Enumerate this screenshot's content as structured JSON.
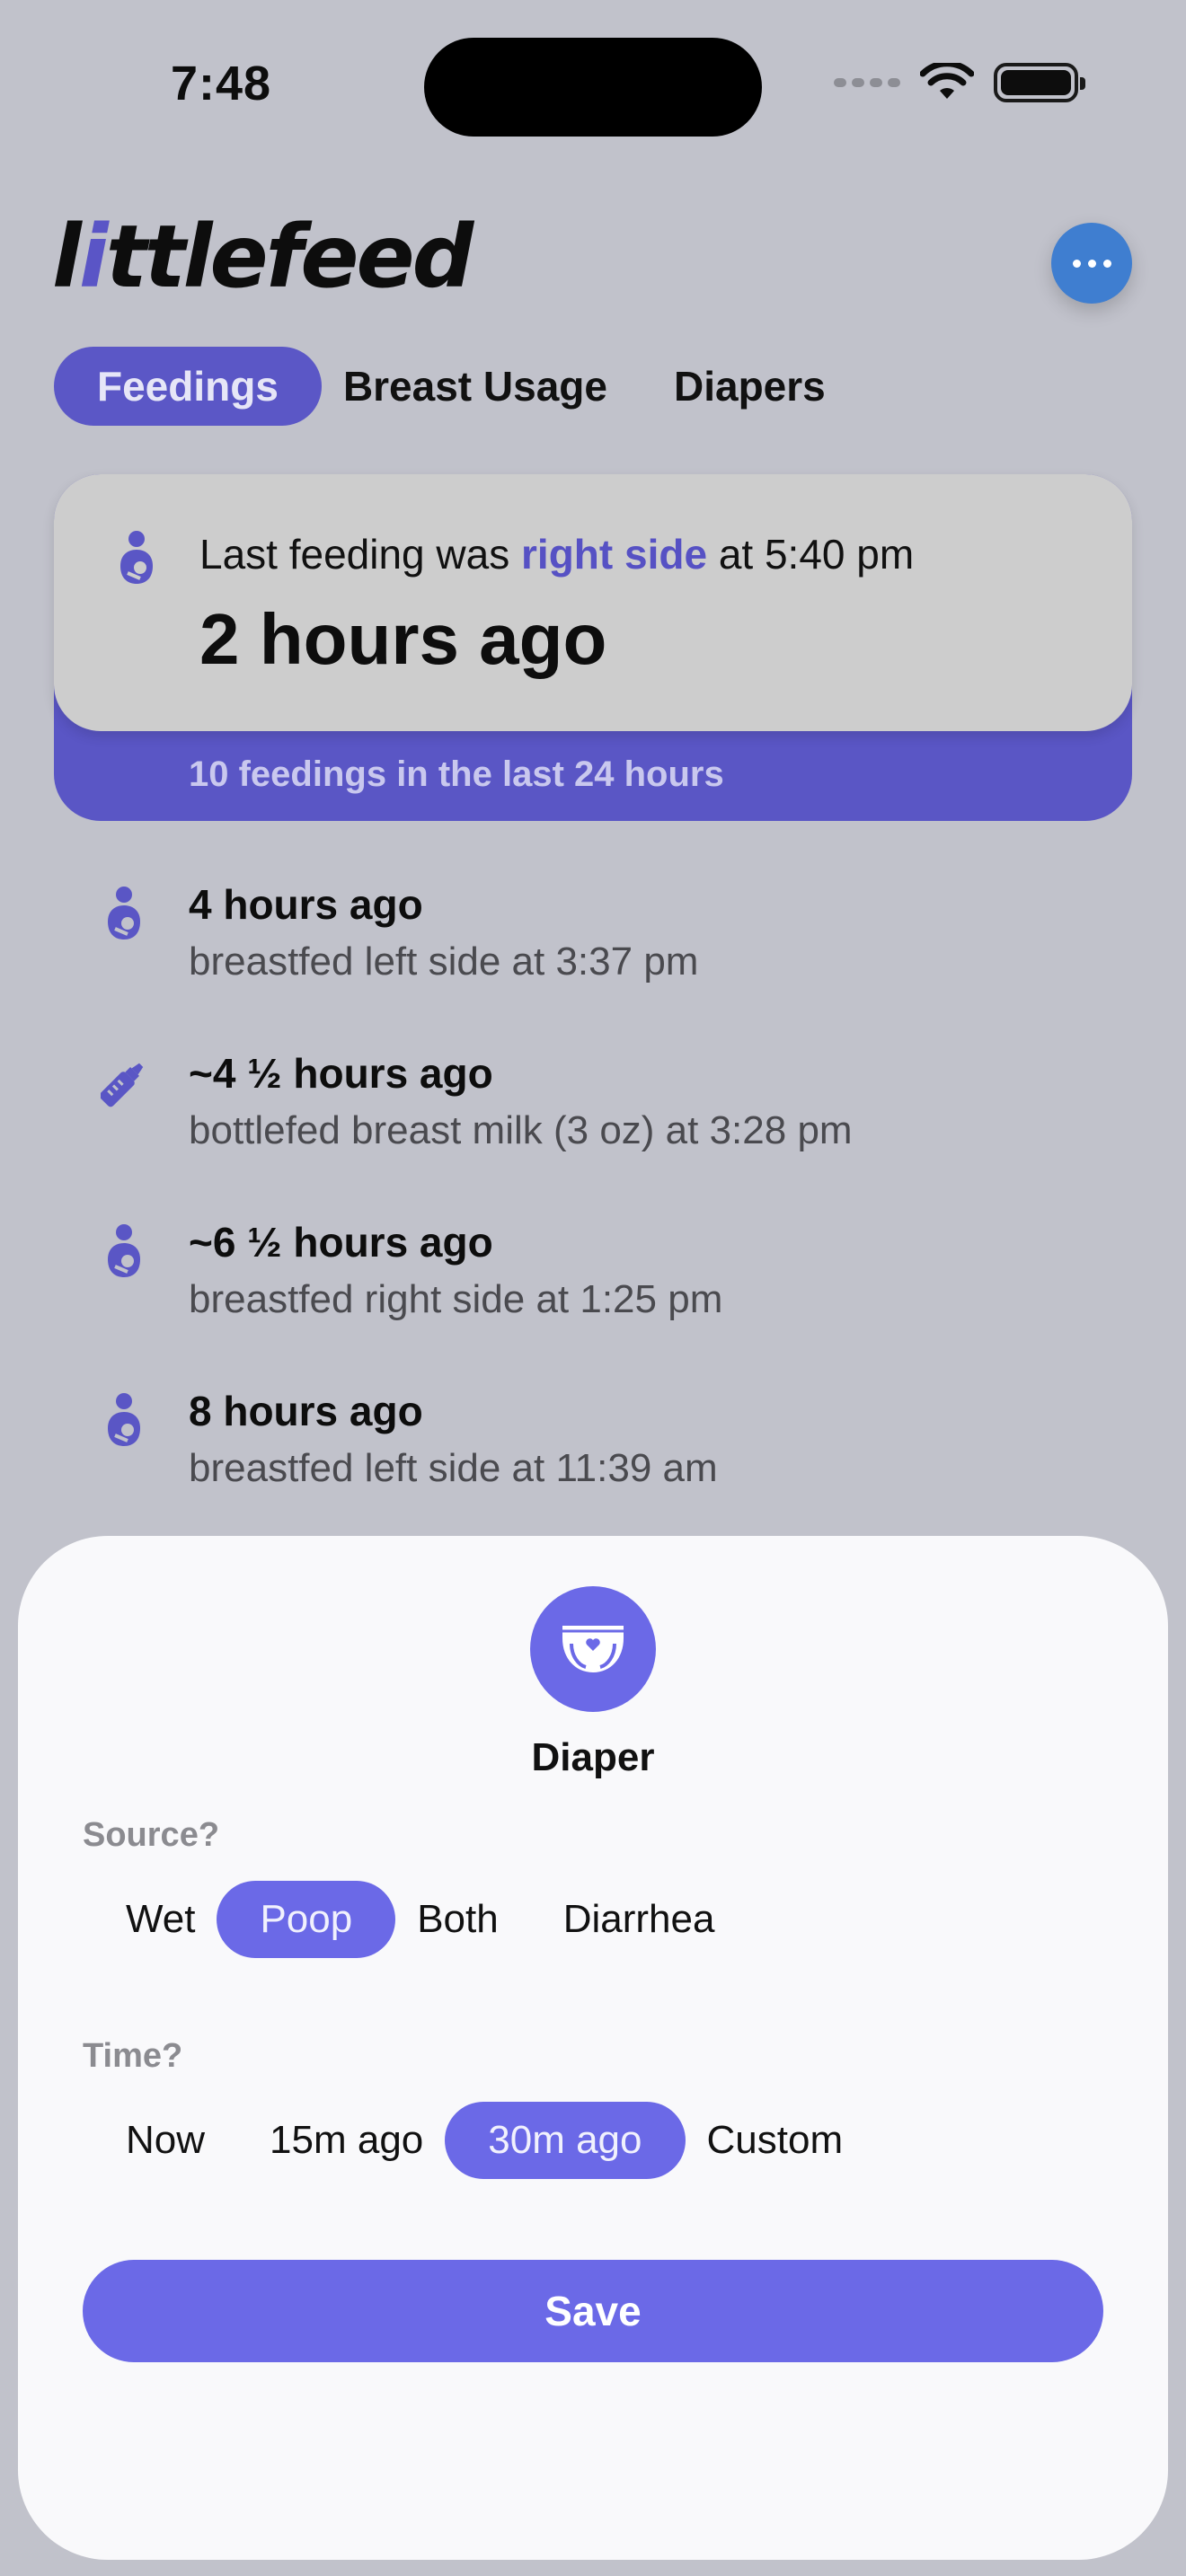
{
  "status_bar": {
    "time": "7:48"
  },
  "header": {
    "logo_prefix": "l",
    "logo_dot_letter": "i",
    "logo_suffix": "ttlefeed",
    "more_icon": "ellipsis-icon",
    "accent_color": "#3f7ed0"
  },
  "tabs": [
    {
      "label": "Feedings",
      "active": true
    },
    {
      "label": "Breast Usage",
      "active": false
    },
    {
      "label": "Diapers",
      "active": false
    }
  ],
  "summary": {
    "prefix": "Last feeding was",
    "side": "right side",
    "suffix": "at 5:40 pm",
    "ago": "2 hours ago",
    "count": "10 feedings in the last 24 hours",
    "icon": "breastfeeding-icon",
    "brand_color": "#5a56c5"
  },
  "feed": [
    {
      "title": "4 hours ago",
      "detail": "breastfed left side at 3:37 pm",
      "icon": "breastfeeding-icon"
    },
    {
      "title": "~4 ½ hours ago",
      "detail": "bottlefed breast milk (3 oz) at 3:28 pm",
      "icon": "bottle-icon"
    },
    {
      "title": "~6 ½ hours ago",
      "detail": "breastfed right side at 1:25 pm",
      "icon": "breastfeeding-icon"
    },
    {
      "title": "8 hours ago",
      "detail": "breastfed left side at 11:39 am",
      "icon": "breastfeeding-icon"
    }
  ],
  "sheet": {
    "title": "Diaper",
    "icon": "diaper-icon",
    "source_label": "Source?",
    "source_options": [
      {
        "label": "Wet",
        "selected": false
      },
      {
        "label": "Poop",
        "selected": true
      },
      {
        "label": "Both",
        "selected": false
      },
      {
        "label": "Diarrhea",
        "selected": false
      }
    ],
    "time_label": "Time?",
    "time_options": [
      {
        "label": "Now",
        "selected": false
      },
      {
        "label": "15m ago",
        "selected": false
      },
      {
        "label": "30m ago",
        "selected": true
      },
      {
        "label": "Custom",
        "selected": false
      }
    ],
    "save_label": "Save",
    "accent_color": "#6b69e7"
  }
}
